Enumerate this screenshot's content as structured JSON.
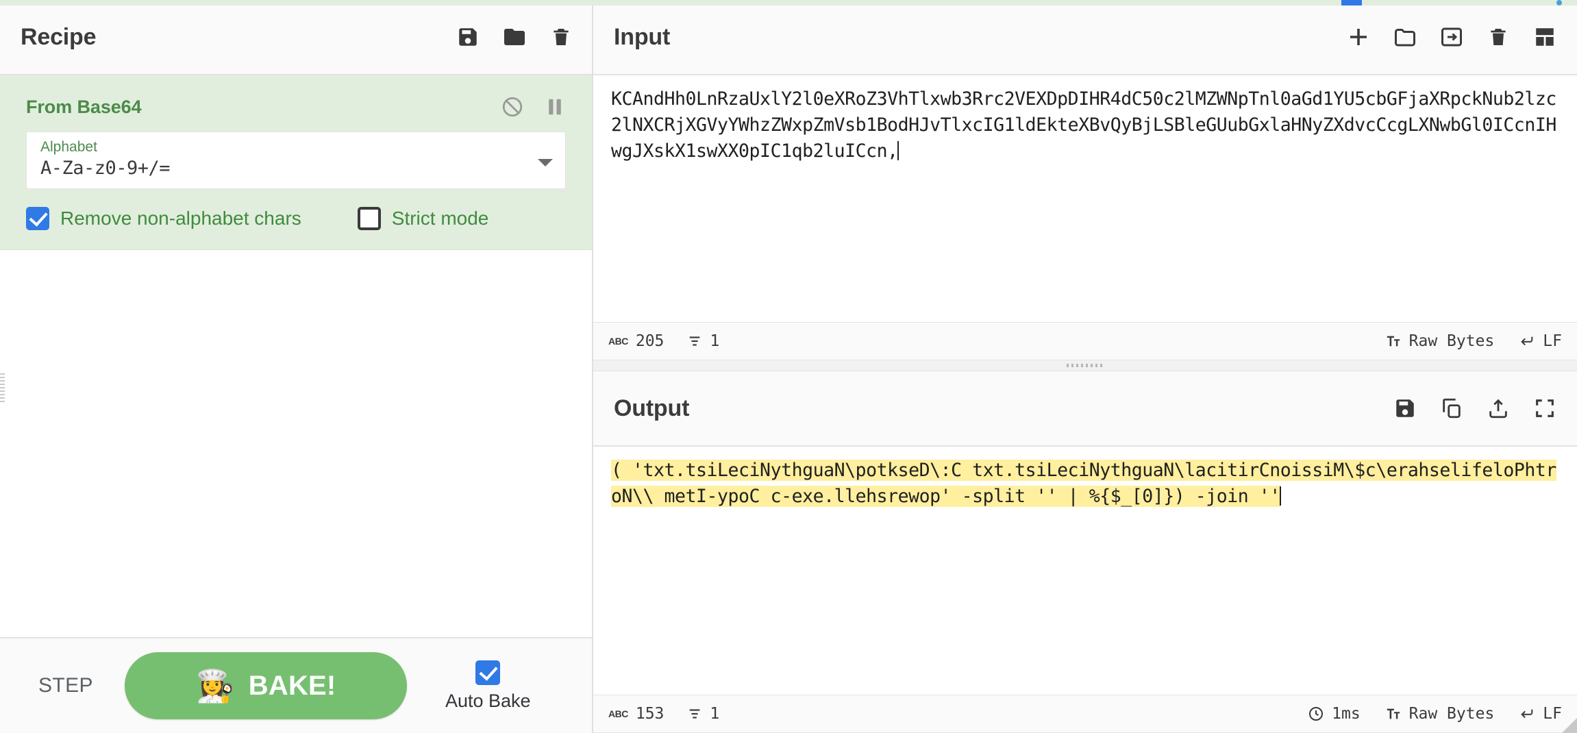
{
  "recipe": {
    "title": "Recipe",
    "header_icons": [
      {
        "name": "save-recipe-icon",
        "glyph": "save"
      },
      {
        "name": "load-recipe-icon",
        "glyph": "folder"
      },
      {
        "name": "clear-recipe-icon",
        "glyph": "trash"
      }
    ],
    "operation": {
      "name": "From Base64",
      "disable_icon": "disable-operation-icon",
      "breakpoint_icon": "pause-breakpoint-icon",
      "arg_label": "Alphabet",
      "arg_value": "A-Za-z0-9+/=",
      "checkbox_1": {
        "label": "Remove non-alphabet chars",
        "checked": true
      },
      "checkbox_2": {
        "label": "Strict mode",
        "checked": false
      }
    },
    "controls": {
      "step_label": "STEP",
      "bake_label": "BAKE!",
      "bake_emoji": "👩‍🍳",
      "auto_bake_label": "Auto Bake",
      "auto_bake_checked": true,
      "bake_color": "#76bf70"
    }
  },
  "input": {
    "title": "Input",
    "header_icons": [
      {
        "name": "add-input-tab-icon",
        "glyph": "plus"
      },
      {
        "name": "open-folder-as-input-icon",
        "glyph": "folder"
      },
      {
        "name": "open-file-as-input-icon",
        "glyph": "file-in"
      },
      {
        "name": "clear-input-icon",
        "glyph": "trash"
      },
      {
        "name": "reset-pane-layout-icon",
        "glyph": "layout"
      }
    ],
    "text": "KCAndHh0LnRzaUxlY2l0eXRoZ3VhTlxwb3Rrc2VEXDpDIHR4dC50c2lMZWNpTnl0aGd1YU5cbGFjaXRpckNub2lzc2lNXCRjXGVyYWhzZWxpZmVsb1BodHJvTlxcIG1ldEkteXBvQyBjLSBleGUubGxlaHNyZXdvcCcgLXNwbGl0ICcnIHwgJXskX1swXX0pIC1qb2luICcn,",
    "status": {
      "length_icon": "character-count-icon",
      "length": "205",
      "lines_icon": "line-count-icon",
      "lines": "1",
      "encoding_icon": "character-encoding-icon",
      "encoding": "Raw Bytes",
      "eol_icon": "line-ending-icon",
      "eol": "LF"
    }
  },
  "output": {
    "title": "Output",
    "header_icons": [
      {
        "name": "save-output-icon",
        "glyph": "save"
      },
      {
        "name": "copy-output-icon",
        "glyph": "copy"
      },
      {
        "name": "replace-input-with-output-icon",
        "glyph": "file-out"
      },
      {
        "name": "maximise-output-icon",
        "glyph": "expand"
      }
    ],
    "text": "( 'txt.tsiLeciNythguaN\\potkseD\\:C txt.tsiLeciNythguaN\\lacitirCnoissiM\\$c\\erahselifeloPhtroN\\\\ metI-ypoC c-exe.llehsrewop' -split '' | %{$_[0]}) -join ''",
    "highlight_color": "#ffef9e",
    "status": {
      "length_icon": "character-count-icon",
      "length": "153",
      "lines_icon": "line-count-icon",
      "lines": "1",
      "timing_icon": "bake-time-icon",
      "timing": "1ms",
      "encoding_icon": "character-encoding-icon",
      "encoding": "Raw Bytes",
      "eol_icon": "line-ending-icon",
      "eol": "LF"
    }
  }
}
